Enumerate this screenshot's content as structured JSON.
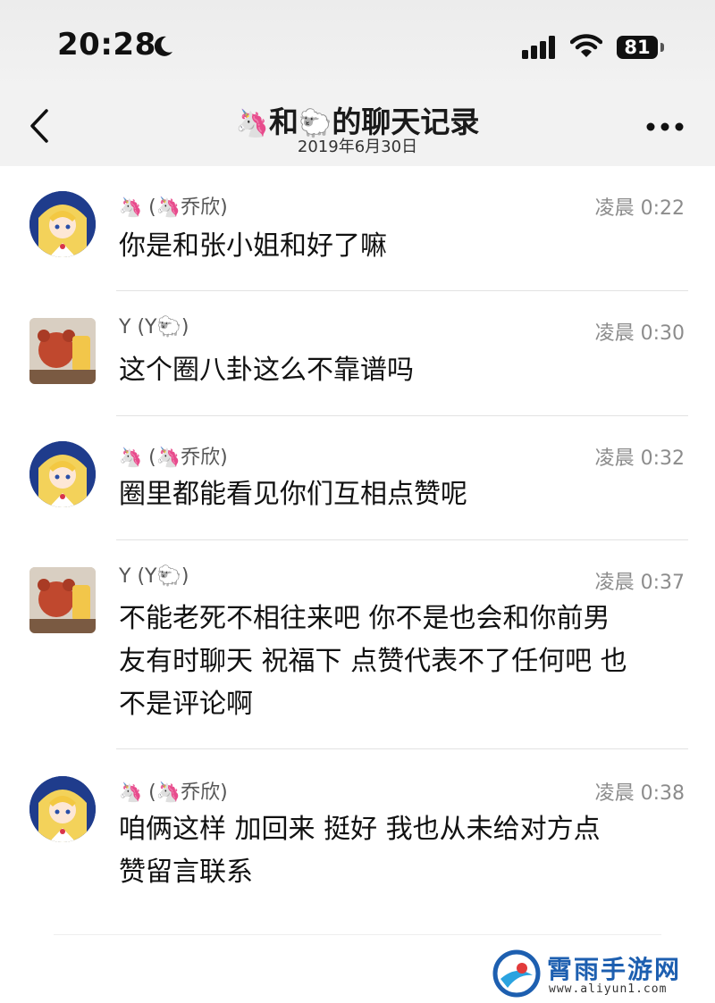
{
  "status_bar": {
    "time": "20:28",
    "battery": "81",
    "icons": [
      "moon-icon",
      "signal-icon",
      "wifi-icon",
      "battery-icon"
    ]
  },
  "nav": {
    "title_prefix_emoji": "🦄",
    "title_mid": "和",
    "title_mid_emoji": "🐑",
    "title_suffix": "的聊天记录",
    "subtitle": "2019年6月30日",
    "icons": [
      "back-chevron-icon",
      "more-icon"
    ]
  },
  "messages": [
    {
      "sender_emoji": "🦄",
      "sender_paren": "(🦄乔欣)",
      "time": "凌晨 0:22",
      "lines": [
        "你是和张小姐和好了嘛"
      ]
    },
    {
      "sender_emoji": "Y",
      "sender_paren": "(Y🐑)",
      "time": "凌晨 0:30",
      "lines": [
        "这个圈八卦这么不靠谱吗"
      ]
    },
    {
      "sender_emoji": "🦄",
      "sender_paren": "(🦄乔欣)",
      "time": "凌晨 0:32",
      "lines": [
        "圈里都能看见你们互相点赞呢"
      ]
    },
    {
      "sender_emoji": "Y",
      "sender_paren": "(Y🐑)",
      "time": "凌晨 0:37",
      "lines": [
        "不能老死不相往来吧 你不是也会和你前男",
        "友有时聊天 祝福下 点赞代表不了任何吧 也",
        "不是评论啊"
      ]
    },
    {
      "sender_emoji": "🦄",
      "sender_paren": "(🦄乔欣)",
      "time": "凌晨 0:38",
      "lines": [
        "咱俩这样 加回来 挺好  我也从未给对方点",
        "赞留言联系"
      ]
    }
  ],
  "watermark": {
    "text": "霄雨手游网",
    "url": "www.aliyun1.com"
  },
  "colors": {
    "accent_blue": "#1d5fb0",
    "time_gray": "#8c8c8c",
    "header_bg": "#f2f2f2"
  }
}
